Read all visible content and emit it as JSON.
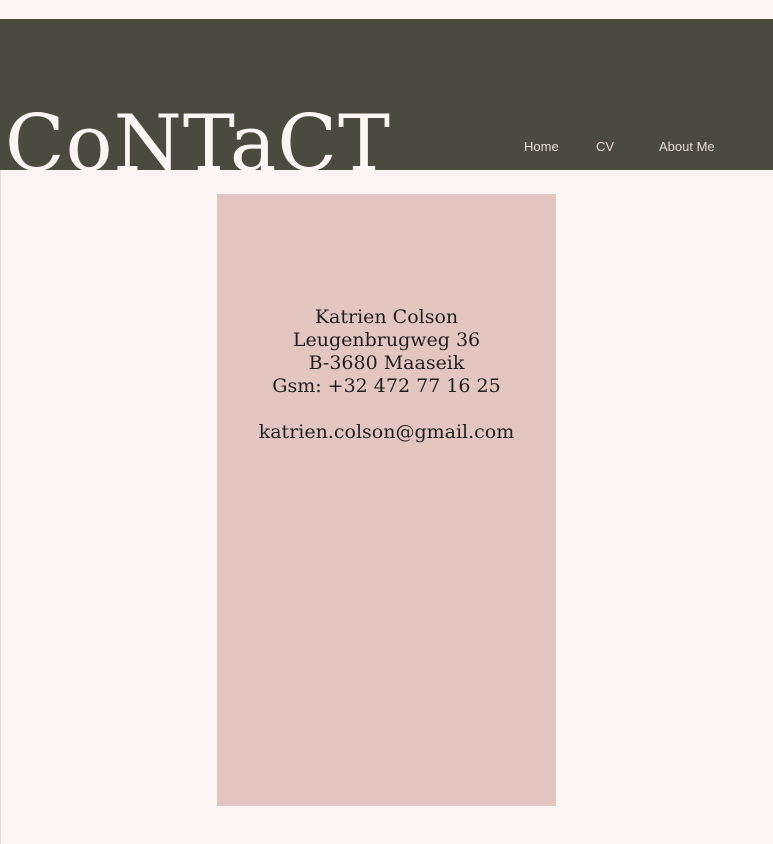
{
  "header": {
    "title": "CoNTaCT"
  },
  "nav": {
    "items": [
      {
        "label": "Home"
      },
      {
        "label": "CV"
      },
      {
        "label": "About Me"
      }
    ]
  },
  "contact": {
    "name": "Katrien Colson",
    "street": "Leugenbrugweg 36",
    "city": "B-3680 Maaseik",
    "phone": "Gsm: +32 472 77 16 25",
    "email": "katrien.colson@gmail.com"
  },
  "colors": {
    "header_bg": "#4b4a3f",
    "page_bg": "#fdf5f3",
    "card_bg": "#e3c6c0",
    "title_text": "#fdf5f3",
    "nav_text": "#e6dcd6"
  }
}
